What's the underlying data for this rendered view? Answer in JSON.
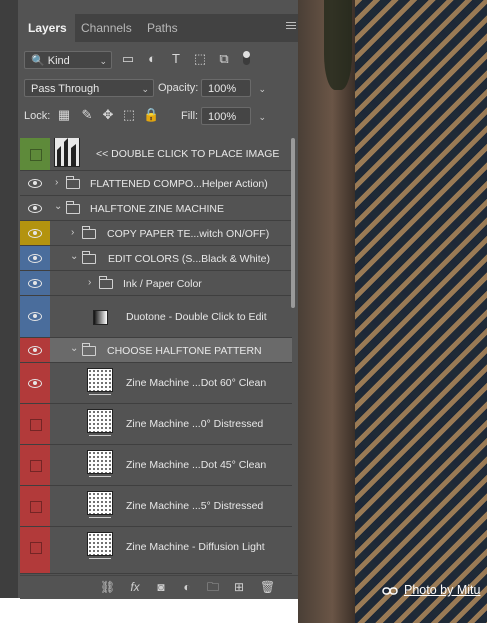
{
  "tabs": [
    "Layers",
    "Channels",
    "Paths"
  ],
  "filter": {
    "kind": "Kind"
  },
  "blend": {
    "mode": "Pass Through",
    "opacity_label": "Opacity:",
    "opacity_value": "100%"
  },
  "lock": {
    "label": "Lock:",
    "fill_label": "Fill:",
    "fill_value": "100%"
  },
  "layers": [
    {
      "name": "<< DOUBLE CLICK TO PLACE IMAGE"
    },
    {
      "name": "FLATTENED COMPO...Helper Action)"
    },
    {
      "name": "HALFTONE ZINE MACHINE"
    },
    {
      "name": "COPY PAPER TE...witch ON/OFF)"
    },
    {
      "name": "EDIT COLORS (S...Black & White)"
    },
    {
      "name": "Ink / Paper Color"
    },
    {
      "name": "Duotone - Double Click to Edit"
    },
    {
      "name": "CHOOSE HALFTONE PATTERN"
    },
    {
      "name": "Zine Machine ...Dot 60° Clean"
    },
    {
      "name": "Zine Machine ...0° Distressed"
    },
    {
      "name": "Zine Machine ...Dot 45° Clean"
    },
    {
      "name": "Zine Machine ...5° Distressed"
    },
    {
      "name": "Zine Machine - Diffusion Light"
    }
  ],
  "colors": {
    "green": "#5e8a3a",
    "yellow": "#b3930f",
    "blue": "#4a6d9c",
    "red": "#b23a3a",
    "selected": "#6a6a6a"
  },
  "credit": "Photo by Mitu"
}
